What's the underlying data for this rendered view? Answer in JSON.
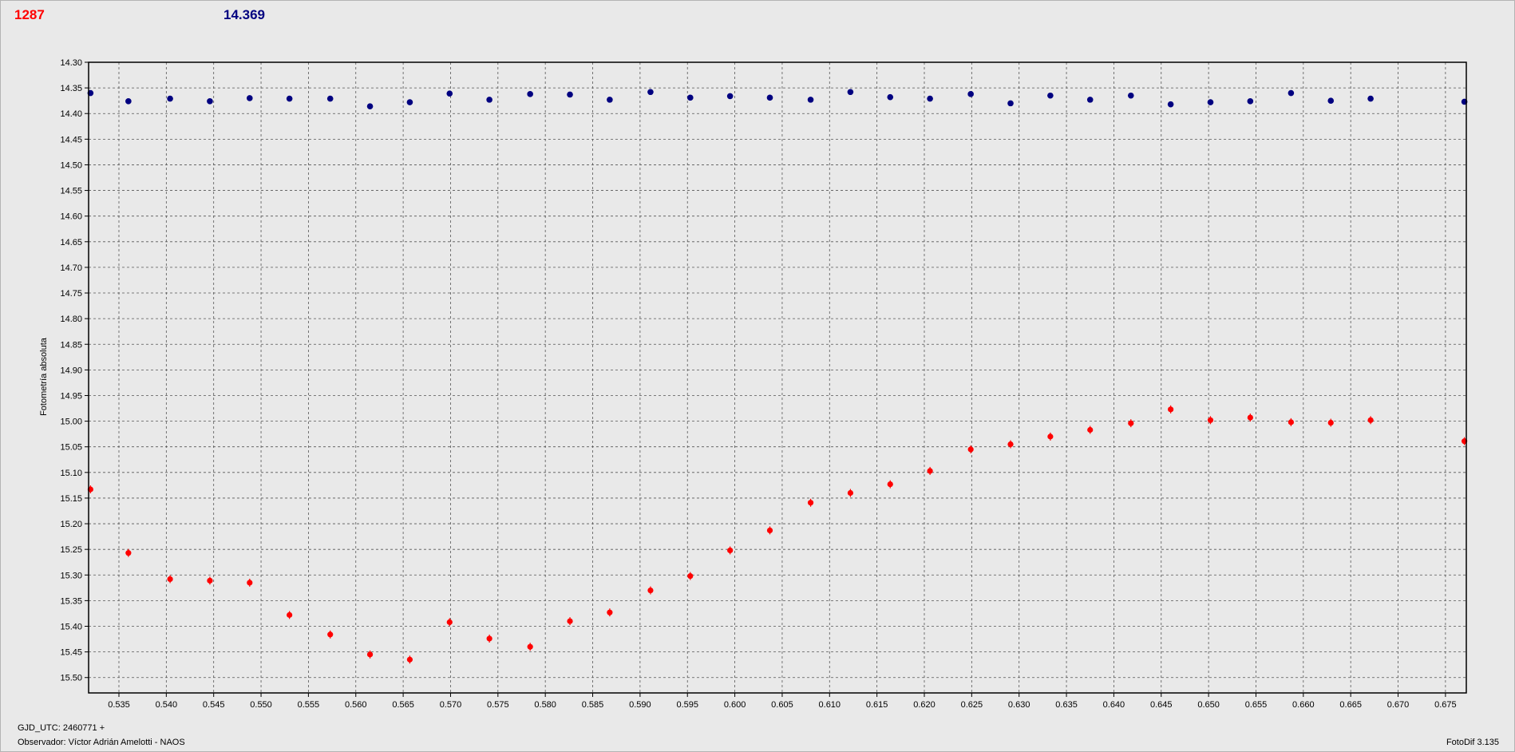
{
  "header": {
    "target_label": "1287",
    "target_color": "#ff0000",
    "comparison_value": "14.369",
    "comparison_color": "#000080"
  },
  "footer": {
    "gjd": "GJD_UTC: 2460771 +",
    "observer": "Observador: Víctor Adrián Amelotti - NAOS",
    "version": "FotoDif 3.135"
  },
  "chart_data": {
    "type": "scatter",
    "ylabel": "Fotometría absoluta",
    "xlabel": "",
    "xlim": [
      0.5318,
      0.6772
    ],
    "ylim": [
      15.53,
      14.3
    ],
    "y_inverted": true,
    "grid": true,
    "grid_style": "dashed",
    "x_ticks": [
      "0.535",
      "0.540",
      "0.545",
      "0.550",
      "0.555",
      "0.560",
      "0.565",
      "0.570",
      "0.575",
      "0.580",
      "0.585",
      "0.590",
      "0.595",
      "0.600",
      "0.605",
      "0.610",
      "0.615",
      "0.620",
      "0.625",
      "0.630",
      "0.635",
      "0.640",
      "0.645",
      "0.650",
      "0.655",
      "0.660",
      "0.665",
      "0.670",
      "0.675"
    ],
    "y_ticks": [
      "14.30",
      "14.35",
      "14.40",
      "14.45",
      "14.50",
      "14.55",
      "14.60",
      "14.65",
      "14.70",
      "14.75",
      "14.80",
      "14.85",
      "14.90",
      "14.95",
      "15.00",
      "15.05",
      "15.10",
      "15.15",
      "15.20",
      "15.25",
      "15.30",
      "15.35",
      "15.40",
      "15.45",
      "15.50"
    ],
    "series": [
      {
        "color": "#000080",
        "x": [
          0.532,
          0.536,
          0.5404,
          0.5446,
          0.5488,
          0.553,
          0.5573,
          0.5615,
          0.5657,
          0.5699,
          0.5741,
          0.5784,
          0.5826,
          0.5868,
          0.5911,
          0.5953,
          0.5995,
          0.6037,
          0.608,
          0.6122,
          0.6164,
          0.6206,
          0.6249,
          0.6291,
          0.6333,
          0.6375,
          0.6418,
          0.646,
          0.6502,
          0.6544,
          0.6587,
          0.6629,
          0.6671,
          0.677
        ],
        "y": [
          14.36,
          14.376,
          14.371,
          14.376,
          14.37,
          14.371,
          14.371,
          14.386,
          14.378,
          14.361,
          14.373,
          14.362,
          14.363,
          14.373,
          14.358,
          14.369,
          14.366,
          14.369,
          14.373,
          14.358,
          14.368,
          14.371,
          14.362,
          14.38,
          14.365,
          14.373,
          14.365,
          14.382,
          14.378,
          14.376,
          14.36,
          14.375,
          14.371,
          14.377
        ]
      },
      {
        "color": "#ff0000",
        "x": [
          0.532,
          0.536,
          0.5404,
          0.5446,
          0.5488,
          0.553,
          0.5573,
          0.5615,
          0.5657,
          0.5699,
          0.5741,
          0.5784,
          0.5826,
          0.5868,
          0.5911,
          0.5953,
          0.5995,
          0.6037,
          0.608,
          0.6122,
          0.6164,
          0.6206,
          0.6249,
          0.6291,
          0.6333,
          0.6375,
          0.6418,
          0.646,
          0.6502,
          0.6544,
          0.6587,
          0.6629,
          0.6671,
          0.677
        ],
        "y": [
          15.133,
          15.257,
          15.308,
          15.311,
          15.315,
          15.378,
          15.416,
          15.455,
          15.465,
          15.392,
          15.424,
          15.44,
          15.39,
          15.373,
          15.33,
          15.302,
          15.252,
          15.213,
          15.159,
          15.14,
          15.123,
          15.097,
          15.055,
          15.045,
          15.03,
          15.017,
          15.004,
          14.977,
          14.998,
          14.993,
          15.002,
          15.003,
          14.998,
          15.039
        ]
      }
    ]
  }
}
